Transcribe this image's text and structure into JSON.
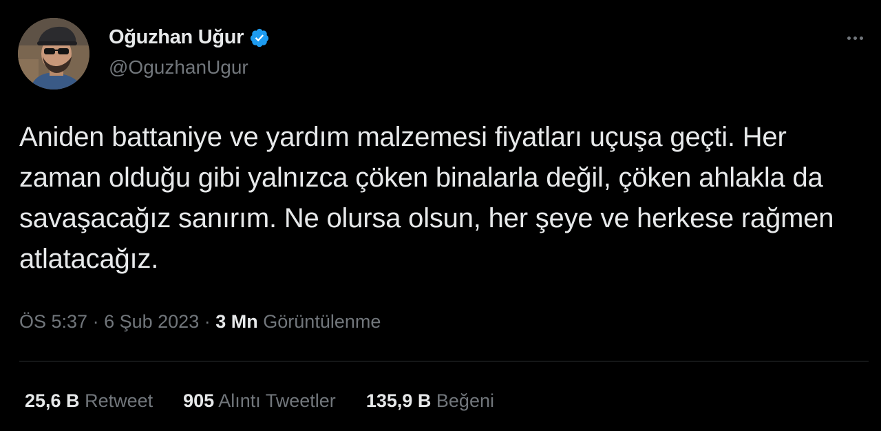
{
  "author": {
    "display_name": "Oğuzhan Uğur",
    "handle": "@OguzhanUgur",
    "verified_icon": "verified-badge-icon",
    "avatar_icon": "profile-photo",
    "badge_color": "#1d9bf0"
  },
  "more_icon": "more-options-icon",
  "tweet": {
    "text": "Aniden battaniye ve yardım malzemesi fiyatları uçuşa geçti. Her zaman olduğu gibi yalnızca çöken binalarla değil, çöken ahlakla da savaşacağız sanırım. Ne olursa olsun, her şeye ve herkese rağmen atlatacağız."
  },
  "meta": {
    "time": "ÖS 5:37",
    "separator": "·",
    "date": "6 Şub 2023",
    "views_count": "3 Mn",
    "views_label": "Görüntülenme"
  },
  "stats": {
    "retweets": {
      "count": "25,6 B",
      "label": "Retweet"
    },
    "quotes": {
      "count": "905",
      "label": "Alıntı Tweetler"
    },
    "likes": {
      "count": "135,9 B",
      "label": "Beğeni"
    }
  },
  "colors": {
    "background": "#000000",
    "text": "#e7e9ea",
    "secondary": "#71767b",
    "divider": "#2f3336"
  }
}
